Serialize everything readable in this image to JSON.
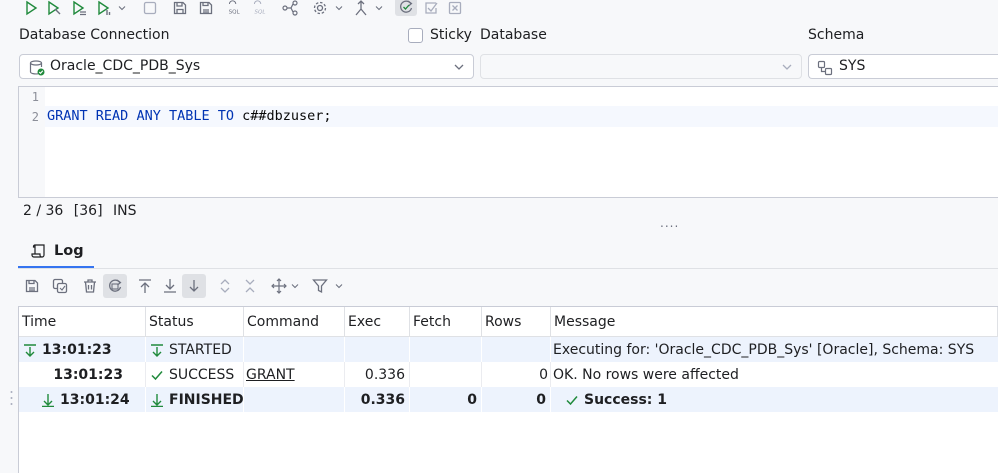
{
  "toolbar": {
    "icons": [
      "execute-icon",
      "execute-cursor-icon",
      "execute-script-icon",
      "execute-plan-icon",
      "dropdown-icon",
      "stop-icon",
      "save-icon",
      "save-as-icon",
      "sql-format-icon",
      "sql-unformat-icon",
      "plan-icon",
      "settings-icon",
      "branch-icon",
      "history-icon",
      "commit-icon",
      "rollback-icon"
    ]
  },
  "connection": {
    "label": "Database Connection",
    "value": "Oracle_CDC_PDB_Sys"
  },
  "sticky": {
    "label": "Sticky",
    "checked": false
  },
  "database": {
    "label": "Database",
    "value": ""
  },
  "schema": {
    "label": "Schema",
    "value": "SYS"
  },
  "editor": {
    "line_numbers": [
      "1",
      "2"
    ],
    "code": {
      "grant": "GRANT",
      "read": "READ",
      "any": "ANY",
      "table": "TABLE",
      "to": "TO",
      "user": "c##dbzuser;"
    }
  },
  "statusbar": {
    "position": "2 / 36",
    "length": "[36]",
    "mode": "INS"
  },
  "splitter": "....",
  "log": {
    "tab_label": "Log",
    "columns": [
      "Time",
      "Status",
      "Command",
      "Exec",
      "Fetch",
      "Rows",
      "Message"
    ],
    "rows": [
      {
        "time": "13:01:23",
        "status": "STARTED",
        "command": "",
        "exec": "",
        "fetch": "",
        "rows": "",
        "message": "Executing for: 'Oracle_CDC_PDB_Sys' [Oracle], Schema: SYS"
      },
      {
        "time": "13:01:23",
        "status": "SUCCESS",
        "command": "GRANT",
        "exec": "0.336",
        "fetch": "",
        "rows": "0",
        "message": "OK. No rows were affected"
      },
      {
        "time": "13:01:24",
        "status": "FINISHED",
        "command": "",
        "exec": "0.336",
        "fetch": "0",
        "rows": "0",
        "message": "Success: 1"
      }
    ]
  },
  "colors": {
    "accent": "#3574f0",
    "keyword": "#0033b3",
    "success": "#208a3c",
    "icon": "#6c707e"
  }
}
